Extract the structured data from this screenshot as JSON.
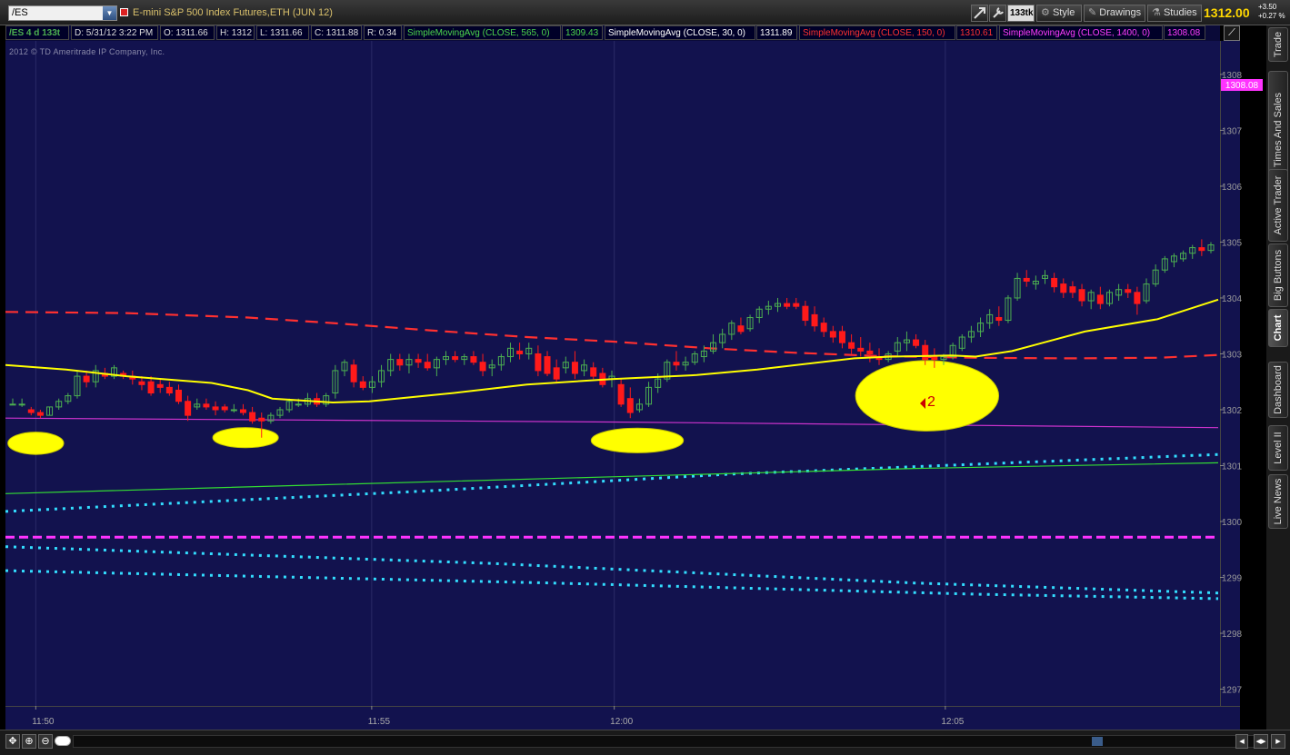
{
  "toolbar": {
    "symbol": "/ES",
    "description": "E-mini S&P 500 Index Futures,ETH (JUN 12)",
    "aggregation": "133tk",
    "style_label": "Style",
    "drawings_label": "Drawings",
    "studies_label": "Studies",
    "last_price": "1312.00",
    "net_change": "+3.50",
    "pct_change": "+0.27 %"
  },
  "info_bar": {
    "symbol_period": "/ES 4 d 133t",
    "date": "D: 5/31/12 3:22 PM",
    "open": "O: 1311.66",
    "high": "H: 1312",
    "low": "L: 1311.66",
    "close": "C: 1311.88",
    "range": "R: 0.34",
    "studies": [
      {
        "label": "SimpleMovingAvg (CLOSE, 565, 0)",
        "value": "1309.43",
        "color": "#4cd64c"
      },
      {
        "label": "SimpleMovingAvg (CLOSE, 30, 0)",
        "value": "1311.89",
        "color": "#ffffff"
      },
      {
        "label": "SimpleMovingAvg (CLOSE, 150, 0)",
        "value": "1310.61",
        "color": "#ff3030"
      },
      {
        "label": "SimpleMovingAvg (CLOSE, 1400, 0)",
        "value": "1308.08",
        "color": "#ff3cff"
      }
    ]
  },
  "copyright": "2012 © TD Ameritrade IP Company, Inc.",
  "price_marker": "1308.08",
  "annotation_label": "2",
  "side_tabs": [
    "Trade",
    "Times And Sales",
    "Active Trader",
    "Big Buttons",
    "Chart",
    "Dashboard",
    "Level II",
    "Live News"
  ],
  "active_tab": "Chart",
  "colors": {
    "chart_bg": "#12124e",
    "up_candle": "#4caf50",
    "down_candle": "#ff1a1a",
    "sma30": "#ffff00",
    "sma150": "#ff3030",
    "sma565": "#33dd33",
    "sma1400": "#cc33cc",
    "bands": "#33ddff",
    "magenta_line": "#ff33ff",
    "highlight": "#ffff00"
  },
  "chart_data": {
    "type": "candlestick",
    "y_ticks": [
      "1297",
      "1298",
      "1299",
      "1300",
      "1301",
      "1302",
      "1303",
      "1304",
      "1305",
      "1306",
      "1307",
      "1308"
    ],
    "x_ticks": [
      "11:50",
      "11:55",
      "12:00",
      "12:05"
    ],
    "ylim": [
      1296.7,
      1308.6
    ],
    "candles": [
      [
        1302.1,
        1302.2,
        1302.1,
        1302.1
      ],
      [
        1302.1,
        1302.2,
        1302.05,
        1302.1
      ],
      [
        1302.0,
        1302.05,
        1301.9,
        1301.95
      ],
      [
        1301.95,
        1302.0,
        1301.85,
        1301.9
      ],
      [
        1301.9,
        1302.05,
        1301.9,
        1302.05
      ],
      [
        1302.05,
        1302.2,
        1302.0,
        1302.15
      ],
      [
        1302.15,
        1302.3,
        1302.1,
        1302.25
      ],
      [
        1302.25,
        1302.7,
        1302.2,
        1302.6
      ],
      [
        1302.6,
        1302.7,
        1302.4,
        1302.5
      ],
      [
        1302.5,
        1302.8,
        1302.4,
        1302.7
      ],
      [
        1302.65,
        1302.75,
        1302.55,
        1302.6
      ],
      [
        1302.6,
        1302.8,
        1302.55,
        1302.75
      ],
      [
        1302.65,
        1302.7,
        1302.55,
        1302.6
      ],
      [
        1302.6,
        1302.7,
        1302.45,
        1302.55
      ],
      [
        1302.5,
        1302.6,
        1302.35,
        1302.45
      ],
      [
        1302.5,
        1302.6,
        1302.25,
        1302.3
      ],
      [
        1302.45,
        1302.55,
        1302.3,
        1302.4
      ],
      [
        1302.4,
        1302.5,
        1302.25,
        1302.3
      ],
      [
        1302.35,
        1302.45,
        1302.1,
        1302.15
      ],
      [
        1302.15,
        1302.25,
        1301.8,
        1301.9
      ],
      [
        1302.05,
        1302.2,
        1302.0,
        1302.1
      ],
      [
        1302.1,
        1302.2,
        1302.0,
        1302.05
      ],
      [
        1302.05,
        1302.15,
        1301.9,
        1302.0
      ],
      [
        1302.05,
        1302.1,
        1301.95,
        1302.0
      ],
      [
        1302.0,
        1302.1,
        1301.95,
        1302.0
      ],
      [
        1302.0,
        1302.1,
        1301.9,
        1301.95
      ],
      [
        1301.95,
        1302.05,
        1301.75,
        1301.8
      ],
      [
        1301.85,
        1301.95,
        1301.5,
        1301.8
      ],
      [
        1301.8,
        1301.95,
        1301.75,
        1301.9
      ],
      [
        1301.9,
        1302.05,
        1301.85,
        1302.0
      ],
      [
        1302.0,
        1302.2,
        1301.95,
        1302.15
      ],
      [
        1302.1,
        1302.2,
        1302.05,
        1302.1
      ],
      [
        1302.1,
        1302.3,
        1302.05,
        1302.2
      ],
      [
        1302.2,
        1302.3,
        1302.05,
        1302.1
      ],
      [
        1302.1,
        1302.3,
        1302.05,
        1302.25
      ],
      [
        1302.3,
        1302.8,
        1302.2,
        1302.7
      ],
      [
        1302.7,
        1302.9,
        1302.6,
        1302.85
      ],
      [
        1302.8,
        1302.9,
        1302.4,
        1302.5
      ],
      [
        1302.5,
        1302.6,
        1302.35,
        1302.4
      ],
      [
        1302.4,
        1302.6,
        1302.3,
        1302.5
      ],
      [
        1302.5,
        1302.8,
        1302.4,
        1302.7
      ],
      [
        1302.7,
        1303.0,
        1302.6,
        1302.9
      ],
      [
        1302.9,
        1303.0,
        1302.7,
        1302.8
      ],
      [
        1302.8,
        1303.0,
        1302.65,
        1302.9
      ],
      [
        1302.9,
        1303.0,
        1302.75,
        1302.85
      ],
      [
        1302.85,
        1303.0,
        1302.7,
        1302.75
      ],
      [
        1302.75,
        1302.95,
        1302.6,
        1302.9
      ],
      [
        1302.9,
        1303.05,
        1302.8,
        1302.95
      ],
      [
        1302.95,
        1303.05,
        1302.85,
        1302.9
      ],
      [
        1302.9,
        1303.0,
        1302.8,
        1302.95
      ],
      [
        1302.95,
        1303.05,
        1302.8,
        1302.85
      ],
      [
        1302.85,
        1303.0,
        1302.6,
        1302.7
      ],
      [
        1302.75,
        1302.9,
        1302.6,
        1302.8
      ],
      [
        1302.8,
        1303.0,
        1302.7,
        1302.95
      ],
      [
        1302.95,
        1303.2,
        1302.85,
        1303.1
      ],
      [
        1303.05,
        1303.2,
        1302.9,
        1303.0
      ],
      [
        1303.0,
        1303.2,
        1302.9,
        1303.1
      ],
      [
        1303.0,
        1303.15,
        1302.6,
        1302.7
      ],
      [
        1302.95,
        1303.05,
        1302.6,
        1302.65
      ],
      [
        1302.75,
        1302.9,
        1302.5,
        1302.55
      ],
      [
        1302.75,
        1302.95,
        1302.65,
        1302.85
      ],
      [
        1302.85,
        1303.05,
        1302.55,
        1302.65
      ],
      [
        1302.7,
        1302.9,
        1302.6,
        1302.8
      ],
      [
        1302.75,
        1302.85,
        1302.55,
        1302.6
      ],
      [
        1302.65,
        1302.75,
        1302.4,
        1302.45
      ],
      [
        1302.55,
        1302.7,
        1302.4,
        1302.6
      ],
      [
        1302.45,
        1302.55,
        1302.05,
        1302.1
      ],
      [
        1302.2,
        1302.4,
        1301.85,
        1301.95
      ],
      [
        1302.0,
        1302.2,
        1301.95,
        1302.1
      ],
      [
        1302.1,
        1302.5,
        1302.05,
        1302.4
      ],
      [
        1302.4,
        1302.65,
        1302.3,
        1302.55
      ],
      [
        1302.55,
        1302.9,
        1302.5,
        1302.85
      ],
      [
        1302.85,
        1303.05,
        1302.7,
        1302.8
      ],
      [
        1302.8,
        1302.95,
        1302.7,
        1302.85
      ],
      [
        1302.85,
        1303.05,
        1302.8,
        1303.0
      ],
      [
        1302.95,
        1303.15,
        1302.85,
        1303.05
      ],
      [
        1303.05,
        1303.35,
        1303.0,
        1303.2
      ],
      [
        1303.2,
        1303.45,
        1303.1,
        1303.35
      ],
      [
        1303.35,
        1303.6,
        1303.25,
        1303.55
      ],
      [
        1303.5,
        1303.65,
        1303.35,
        1303.4
      ],
      [
        1303.45,
        1303.7,
        1303.4,
        1303.65
      ],
      [
        1303.65,
        1303.85,
        1303.55,
        1303.8
      ],
      [
        1303.8,
        1303.95,
        1303.7,
        1303.85
      ],
      [
        1303.85,
        1304.0,
        1303.75,
        1303.9
      ],
      [
        1303.9,
        1304.0,
        1303.8,
        1303.85
      ],
      [
        1303.9,
        1304.0,
        1303.8,
        1303.85
      ],
      [
        1303.85,
        1303.95,
        1303.5,
        1303.6
      ],
      [
        1303.7,
        1303.85,
        1303.4,
        1303.5
      ],
      [
        1303.55,
        1303.65,
        1303.3,
        1303.4
      ],
      [
        1303.4,
        1303.5,
        1303.2,
        1303.3
      ],
      [
        1303.4,
        1303.5,
        1303.1,
        1303.2
      ],
      [
        1303.2,
        1303.35,
        1303.0,
        1303.1
      ],
      [
        1303.1,
        1303.3,
        1302.95,
        1303.05
      ],
      [
        1303.05,
        1303.2,
        1302.85,
        1303.0
      ],
      [
        1302.95,
        1303.1,
        1302.8,
        1302.9
      ],
      [
        1302.9,
        1303.05,
        1302.85,
        1303.0
      ],
      [
        1303.05,
        1303.3,
        1302.95,
        1303.2
      ],
      [
        1303.2,
        1303.4,
        1303.05,
        1303.25
      ],
      [
        1303.25,
        1303.35,
        1303.1,
        1303.15
      ],
      [
        1303.15,
        1303.25,
        1302.8,
        1302.9
      ],
      [
        1302.95,
        1303.1,
        1302.75,
        1302.9
      ],
      [
        1302.9,
        1303.0,
        1302.8,
        1302.95
      ],
      [
        1302.95,
        1303.2,
        1302.9,
        1303.15
      ],
      [
        1303.1,
        1303.35,
        1303.05,
        1303.3
      ],
      [
        1303.3,
        1303.5,
        1303.2,
        1303.4
      ],
      [
        1303.4,
        1303.65,
        1303.3,
        1303.55
      ],
      [
        1303.55,
        1303.8,
        1303.45,
        1303.7
      ],
      [
        1303.65,
        1303.85,
        1303.5,
        1303.6
      ],
      [
        1303.6,
        1304.05,
        1303.55,
        1304.0
      ],
      [
        1304.0,
        1304.45,
        1303.95,
        1304.35
      ],
      [
        1304.35,
        1304.5,
        1304.2,
        1304.3
      ],
      [
        1304.25,
        1304.4,
        1304.15,
        1304.3
      ],
      [
        1304.35,
        1304.5,
        1304.25,
        1304.4
      ],
      [
        1304.35,
        1304.45,
        1304.1,
        1304.2
      ],
      [
        1304.25,
        1304.35,
        1304.0,
        1304.1
      ],
      [
        1304.2,
        1304.3,
        1304.0,
        1304.1
      ],
      [
        1304.15,
        1304.25,
        1303.85,
        1303.95
      ],
      [
        1303.95,
        1304.15,
        1303.8,
        1304.1
      ],
      [
        1304.05,
        1304.2,
        1303.8,
        1303.9
      ],
      [
        1303.9,
        1304.15,
        1303.85,
        1304.1
      ],
      [
        1304.05,
        1304.25,
        1303.95,
        1304.15
      ],
      [
        1304.15,
        1304.25,
        1304.0,
        1304.1
      ],
      [
        1304.1,
        1304.2,
        1303.7,
        1303.9
      ],
      [
        1303.95,
        1304.35,
        1303.9,
        1304.25
      ],
      [
        1304.25,
        1304.6,
        1304.2,
        1304.5
      ],
      [
        1304.5,
        1304.75,
        1304.45,
        1304.7
      ],
      [
        1304.65,
        1304.8,
        1304.55,
        1304.75
      ],
      [
        1304.7,
        1304.85,
        1304.65,
        1304.8
      ],
      [
        1304.8,
        1304.95,
        1304.7,
        1304.9
      ],
      [
        1304.9,
        1305.05,
        1304.75,
        1304.85
      ],
      [
        1304.85,
        1305.0,
        1304.8,
        1304.95
      ]
    ],
    "sma30": [
      [
        1302.8,
        0.0
      ],
      [
        1302.72,
        0.05
      ],
      [
        1302.6,
        0.1
      ],
      [
        1302.48,
        0.17
      ],
      [
        1302.35,
        0.2
      ],
      [
        1302.2,
        0.22
      ],
      [
        1302.13,
        0.27
      ],
      [
        1302.15,
        0.3
      ],
      [
        1302.3,
        0.37
      ],
      [
        1302.45,
        0.43
      ],
      [
        1302.55,
        0.5
      ],
      [
        1302.62,
        0.57
      ],
      [
        1302.72,
        0.62
      ],
      [
        1302.92,
        0.7
      ],
      [
        1302.95,
        0.73
      ],
      [
        1302.97,
        0.78
      ],
      [
        1302.95,
        0.8
      ],
      [
        1303.05,
        0.83
      ],
      [
        1303.4,
        0.89
      ],
      [
        1303.62,
        0.95
      ],
      [
        1303.97,
        1.0
      ]
    ],
    "sma150": [
      [
        1303.75,
        0.0
      ],
      [
        1303.73,
        0.1
      ],
      [
        1303.65,
        0.2
      ],
      [
        1303.55,
        0.27
      ],
      [
        1303.42,
        0.35
      ],
      [
        1303.3,
        0.43
      ],
      [
        1303.22,
        0.5
      ],
      [
        1303.1,
        0.58
      ],
      [
        1303.02,
        0.65
      ],
      [
        1302.96,
        0.72
      ],
      [
        1302.93,
        0.8
      ],
      [
        1302.92,
        0.88
      ],
      [
        1302.93,
        0.95
      ],
      [
        1302.98,
        1.0
      ]
    ],
    "sma565": [
      [
        1300.5,
        0.0
      ],
      [
        1300.65,
        0.25
      ],
      [
        1300.8,
        0.5
      ],
      [
        1300.95,
        0.75
      ],
      [
        1301.05,
        1.0
      ]
    ],
    "sma1400": [
      [
        1301.85,
        0.0
      ],
      [
        1301.78,
        0.5
      ],
      [
        1301.68,
        1.0
      ]
    ],
    "band_upper": [
      [
        1300.18,
        0.0
      ],
      [
        1300.55,
        0.35
      ],
      [
        1300.85,
        0.6
      ],
      [
        1301.2,
        1.0
      ]
    ],
    "band_lower1": [
      [
        1299.55,
        0.0
      ],
      [
        1299.25,
        0.4
      ],
      [
        1298.9,
        0.75
      ],
      [
        1298.72,
        1.0
      ]
    ],
    "band_lower2": [
      [
        1299.12,
        0.0
      ],
      [
        1298.9,
        0.45
      ],
      [
        1298.7,
        0.8
      ],
      [
        1298.62,
        1.0
      ]
    ],
    "magenta_level": 1299.72,
    "highlights": [
      {
        "x_frac": 0.025,
        "price": 1301.4,
        "rx_frac": 0.023,
        "ry_price": 0.2
      },
      {
        "x_frac": 0.198,
        "price": 1301.5,
        "rx_frac": 0.027,
        "ry_price": 0.18
      },
      {
        "x_frac": 0.521,
        "price": 1301.45,
        "rx_frac": 0.038,
        "ry_price": 0.22
      },
      {
        "x_frac": 0.76,
        "price": 1302.25,
        "rx_frac": 0.059,
        "ry_price": 0.63
      }
    ],
    "annotation": {
      "x_frac": 0.762,
      "price": 1302.27
    }
  }
}
